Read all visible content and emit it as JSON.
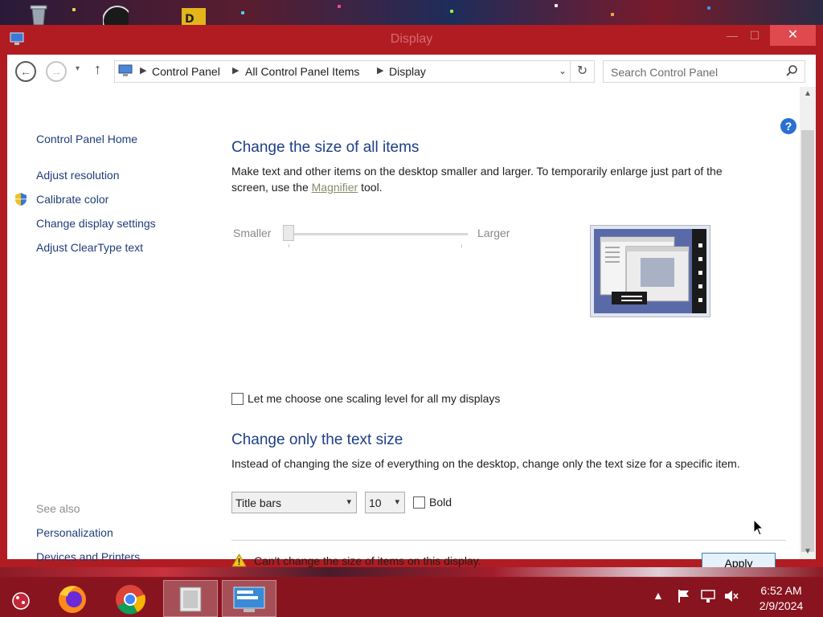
{
  "window": {
    "title": "Display",
    "close_symbol": "✕",
    "minimize_symbol": "—",
    "maximize_symbol": "☐"
  },
  "address_bar": {
    "crumbs": [
      "Control Panel",
      "All Control Panel Items",
      "Display"
    ],
    "search_placeholder": "Search Control Panel"
  },
  "left_nav": {
    "home": "Control Panel Home",
    "items": [
      "Adjust resolution",
      "Calibrate color",
      "Change display settings",
      "Adjust ClearType text"
    ],
    "see_also_heading": "See also",
    "see_also": [
      "Personalization",
      "Devices and Printers"
    ]
  },
  "main": {
    "section1_title": "Change the size of all items",
    "section1_text_a": "Make text and other items on the desktop smaller and larger. To temporarily enlarge just part of the",
    "section1_text_b": "screen, use the",
    "section1_link": "Magnifier",
    "section1_text_c": "tool.",
    "slider": {
      "min_label": "Smaller",
      "max_label": "Larger",
      "value_fraction": 0.0,
      "disabled": true
    },
    "scaling_checkbox_label": "Let me choose one scaling level for all my displays",
    "scaling_checkbox_checked": false,
    "section2_title": "Change only the text size",
    "section2_text": "Instead of changing the size of everything on the desktop, change only the text size for a specific item.",
    "item_select_value": "Title bars",
    "size_select_value": "10",
    "bold_label": "Bold",
    "bold_checked": false,
    "warning_text": "Can't change the size of items on this display.",
    "apply_label": "Apply"
  },
  "taskbar": {
    "apps": [
      "app-bubble-icon",
      "firefox-icon",
      "chrome-icon",
      "file-manager-icon",
      "display-settings-icon"
    ],
    "time": "6:52 AM",
    "date": "2/9/2024"
  },
  "colors": {
    "window_frame": "#b01c22",
    "title_color": "#1e3f87",
    "link_color": "#1e3d79",
    "close_button": "#e0494e"
  }
}
